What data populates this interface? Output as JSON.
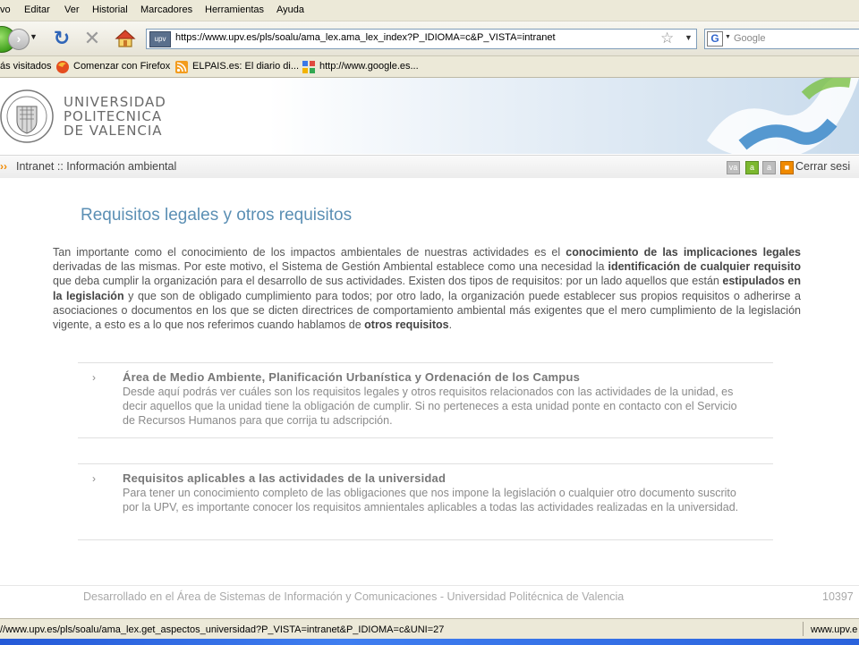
{
  "menu": {
    "items": [
      "vo",
      "Editar",
      "Ver",
      "Historial",
      "Marcadores",
      "Herramientas",
      "Ayuda"
    ]
  },
  "nav": {
    "url": "https://www.upv.es/pls/soalu/ama_lex.ama_lex_index?P_IDIOMA=c&P_VISTA=intranet",
    "site_badge": "upv",
    "search_engine_letter": "G",
    "search_placeholder": "Google"
  },
  "bookmarks": [
    {
      "label": "ás visitados",
      "icon": "none"
    },
    {
      "label": "Comenzar con Firefox",
      "icon": "firefox-icon"
    },
    {
      "label": "ELPAIS.es: El diario di...",
      "icon": "rss-feed-icon"
    },
    {
      "label": "http://www.google.es...",
      "icon": "google-icon"
    }
  ],
  "header": {
    "university_line1": "UNIVERSIDAD",
    "university_line2": "POLITECNICA",
    "university_line3": "DE VALENCIA"
  },
  "breadcrumb": {
    "text": "Intranet :: Información ambiental",
    "logout_label": "Cerrar sesi",
    "tool_buttons": [
      "va",
      "a",
      "a"
    ]
  },
  "content": {
    "title": "Requisitos legales y otros requisitos",
    "intro": [
      {
        "t": "Tan importante como el conocimiento de los impactos ambientales de nuestras actividades es el ",
        "b": false
      },
      {
        "t": "conocimiento de las implicaciones legales",
        "b": true
      },
      {
        "t": " derivadas de las mismas. Por este motivo, el Sistema de Gestión Ambiental establece como una necesidad la ",
        "b": false
      },
      {
        "t": "identificación de cualquier requisito",
        "b": true
      },
      {
        "t": " que deba cumplir la organización para el desarrollo de sus actividades. Existen dos tipos de requisitos: por un lado aquellos que están ",
        "b": false
      },
      {
        "t": "estipulados en la legislación",
        "b": true
      },
      {
        "t": " y que son de obligado cumplimiento para todos; por otro lado, la organización puede establecer sus propios requisitos o adherirse a asociaciones o documentos en los que se dicten directrices de comportamiento ambiental más exigentes que el mero cumplimiento de la legislación vigente, a esto es a lo que nos referimos cuando hablamos de ",
        "b": false
      },
      {
        "t": "otros requisitos",
        "b": true
      },
      {
        "t": ".",
        "b": false
      }
    ],
    "cards": [
      {
        "title": "Área de Medio Ambiente, Planificación Urbanística y Ordenación de los Campus",
        "body": "Desde aquí podrás ver cuáles son los requisitos legales y otros requisitos relacionados con las actividades de la unidad, es decir aquellos que la unidad tiene la obligación de cumplir. Si no perteneces a esta unidad ponte en contacto con el Servicio de Recursos Humanos para que corrija tu adscripción."
      },
      {
        "title": "Requisitos aplicables a las actividades de la universidad",
        "body": "Para tener un conocimiento completo de las obligaciones que nos impone la legislación o cualquier otro documento suscrito por la UPV, es importante conocer los requisitos amnientales aplicables a todas las actividades realizadas en la universidad."
      }
    ],
    "footer_text_a": "Desarrollado en el Área de Sistemas de Información y Comunicaciones",
    "footer_dash": " - ",
    "footer_text_b": "Universidad Politécnica de Valencia",
    "footer_number": "10397"
  },
  "status": {
    "text": "//www.upv.es/pls/soalu/ama_lex.get_aspectos_universidad?P_VISTA=intranet&P_IDIOMA=c&UNI=27",
    "right": "www.upv.e"
  },
  "colors": {
    "title_blue": "#5b8fb4",
    "breadcrumb_arrow": "#f08a00"
  }
}
